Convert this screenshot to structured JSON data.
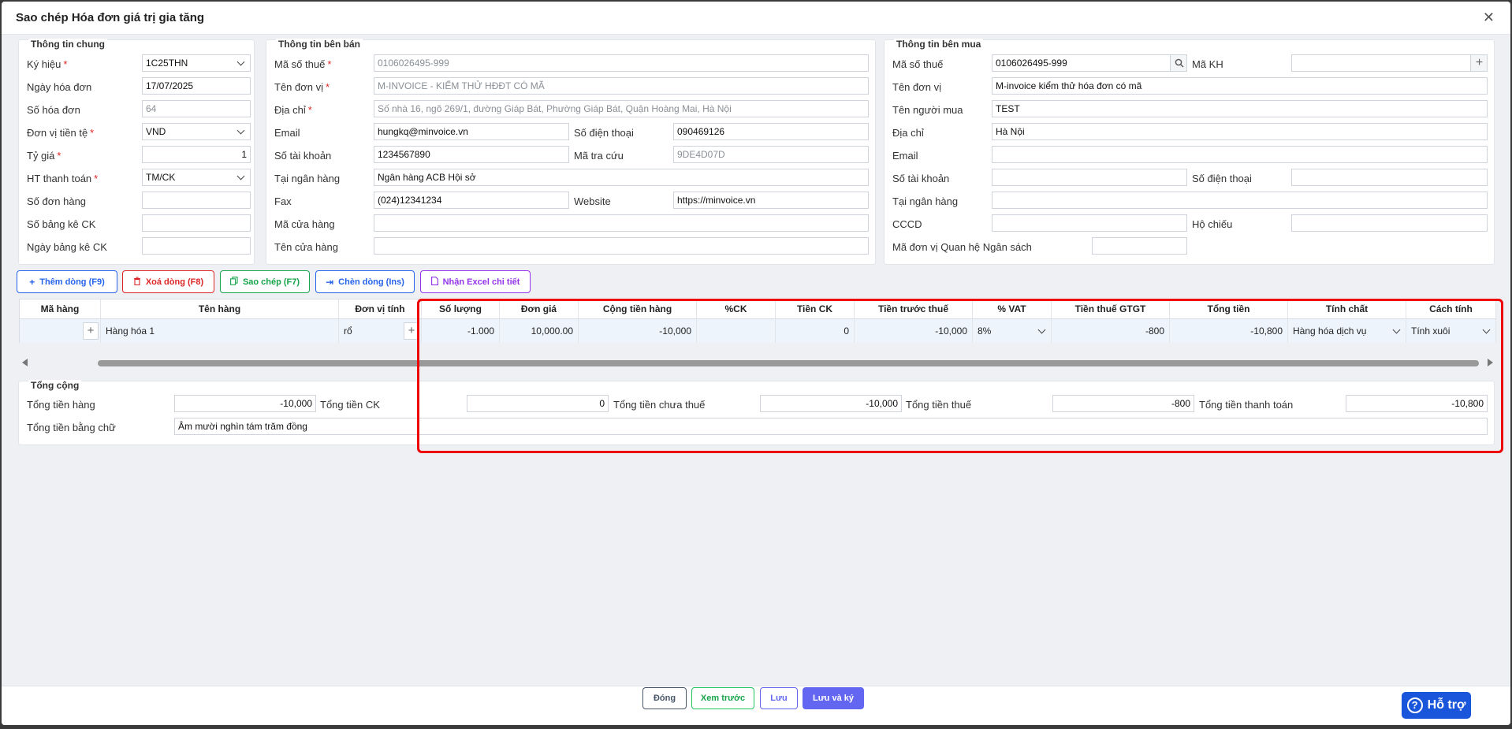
{
  "dialog": {
    "title": "Sao chép Hóa đơn giá trị gia tăng",
    "close_glyph": "✕"
  },
  "general": {
    "title": "Thông tin chung",
    "fields": {
      "ky_hieu": {
        "label": "Ký hiệu",
        "value": "1C25THN"
      },
      "ngay_hd": {
        "label": "Ngày hóa đơn",
        "value": "17/07/2025"
      },
      "so_hd": {
        "label": "Số hóa đơn",
        "value": "64"
      },
      "don_vi_tt": {
        "label": "Đơn vị tiền tệ",
        "value": "VND"
      },
      "ty_gia": {
        "label": "Tỷ giá",
        "value": "1"
      },
      "ht_tt": {
        "label": "HT thanh toán",
        "value": "TM/CK"
      },
      "so_don_hang": {
        "label": "Số đơn hàng",
        "value": ""
      },
      "so_bang_ke": {
        "label": "Số bảng kê CK",
        "value": ""
      },
      "ngay_bang_ke": {
        "label": "Ngày bảng kê CK",
        "value": ""
      }
    }
  },
  "seller": {
    "title": "Thông tin bên bán",
    "fields": {
      "mst": {
        "label": "Mã số thuế",
        "value": "0106026495-999"
      },
      "ten_dv": {
        "label": "Tên đơn vị",
        "value": "M-INVOICE - KIỂM THỬ HĐĐT CÓ MÃ"
      },
      "dia_chi": {
        "label": "Địa chỉ",
        "value": "Số nhà 16, ngõ 269/1, đường Giáp Bát, Phường Giáp Bát, Quận Hoàng Mai, Hà Nội"
      },
      "email": {
        "label": "Email",
        "value": "hungkq@minvoice.vn"
      },
      "sdt": {
        "label": "Số điện thoại",
        "value": "090469126"
      },
      "so_tk": {
        "label": "Số tài khoản",
        "value": "1234567890"
      },
      "ma_tra_cuu": {
        "label": "Mã tra cứu",
        "value": "9DE4D07D"
      },
      "ngan_hang": {
        "label": "Tại ngân hàng",
        "value": "Ngân hàng ACB Hội sở"
      },
      "fax": {
        "label": "Fax",
        "value": "(024)12341234"
      },
      "website": {
        "label": "Website",
        "value": "https://minvoice.vn"
      },
      "ma_cua_hang": {
        "label": "Mã cửa hàng",
        "value": ""
      },
      "ten_cua_hang": {
        "label": "Tên cửa hàng",
        "value": ""
      }
    }
  },
  "buyer": {
    "title": "Thông tin bên mua",
    "fields": {
      "mst": {
        "label": "Mã số thuế",
        "value": "0106026495-999"
      },
      "ma_kh": {
        "label": "Mã KH",
        "value": ""
      },
      "ten_dv": {
        "label": "Tên đơn vị",
        "value": "M-invoice kiểm thử hóa đơn có mã"
      },
      "nguoi_mua": {
        "label": "Tên người mua",
        "value": "TEST"
      },
      "dia_chi": {
        "label": "Địa chỉ",
        "value": "Hà Nội"
      },
      "email": {
        "label": "Email",
        "value": ""
      },
      "so_tk": {
        "label": "Số tài khoản",
        "value": ""
      },
      "sdt": {
        "label": "Số điện thoại",
        "value": ""
      },
      "ngan_hang": {
        "label": "Tại ngân hàng",
        "value": ""
      },
      "cccd": {
        "label": "CCCD",
        "value": ""
      },
      "ho_chieu": {
        "label": "Hộ chiếu",
        "value": ""
      },
      "ma_qhns": {
        "label": "Mã đơn vị Quan hệ Ngân sách",
        "value": ""
      }
    }
  },
  "toolbar": {
    "add": "Thêm dòng (F9)",
    "delete": "Xoá dòng (F8)",
    "copy": "Sao chép (F7)",
    "insert": "Chèn dòng (Ins)",
    "excel": "Nhận Excel chi tiết"
  },
  "grid": {
    "headers": [
      "Mã hàng",
      "Tên hàng",
      "Đơn vị tính",
      "Số lượng",
      "Đơn giá",
      "Cộng tiền hàng",
      "%CK",
      "Tiền CK",
      "Tiền trước thuế",
      "% VAT",
      "Tiền thuế GTGT",
      "Tổng tiền",
      "Tính chất",
      "Cách tính"
    ],
    "row": {
      "ma_hang": "",
      "ten_hang": "Hàng hóa 1",
      "dvt": "rổ",
      "so_luong": "-1.000",
      "don_gia": "10,000.00",
      "cong_tien": "-10,000",
      "ck_pct": "",
      "tien_ck": "0",
      "tien_truoc_thue": "-10,000",
      "vat": "8%",
      "tien_thue": "-800",
      "tong_tien": "-10,800",
      "tinh_chat": "Hàng hóa dịch vụ",
      "cach_tinh": "Tính xuôi"
    }
  },
  "totals": {
    "title": "Tổng cộng",
    "tong_tien_hang": {
      "label": "Tổng tiền hàng",
      "value": "-10,000"
    },
    "tong_tien_ck": {
      "label": "Tổng tiền CK",
      "value": "0"
    },
    "tong_chua_thue": {
      "label": "Tổng tiền chưa thuế",
      "value": "-10,000"
    },
    "tong_thue": {
      "label": "Tổng tiền thuế",
      "value": "-800"
    },
    "tong_thanh_toan": {
      "label": "Tổng tiền thanh toán",
      "value": "-10,800"
    },
    "bang_chu": {
      "label": "Tổng tiền bằng chữ",
      "value": "Âm mười nghìn tám trăm đồng"
    }
  },
  "footer": {
    "close": "Đóng",
    "preview": "Xem trước",
    "save": "Lưu",
    "save_sign": "Lưu và ký"
  },
  "help": {
    "label": "Hỗ trợ"
  },
  "colors": {
    "primary": "#6366f1",
    "add": "#2563eb",
    "delete": "#dc2626",
    "copy": "#16a34a",
    "insert": "#2563eb",
    "excel": "#9333ea",
    "highlight": "#ee0000"
  }
}
